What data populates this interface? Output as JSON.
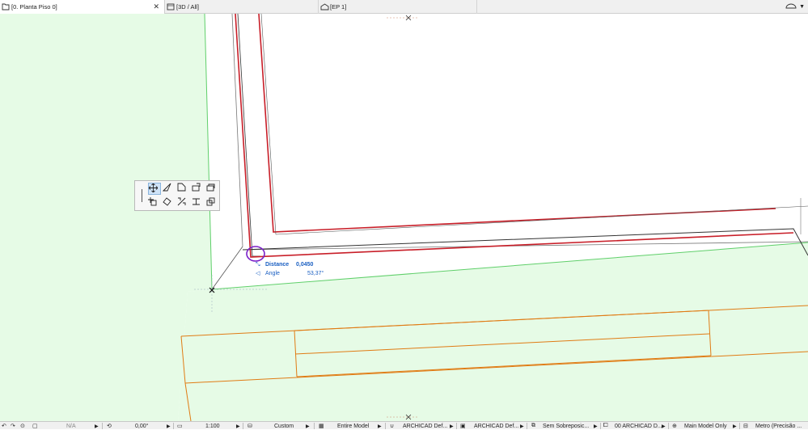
{
  "tabs": [
    {
      "label": "[0. Planta Piso 0]",
      "icon": "floor-plan-icon",
      "close": "✕"
    },
    {
      "label": "[3D / All]",
      "icon": "3d-window-icon"
    },
    {
      "label": "[EP 1]",
      "icon": "elevation-icon"
    }
  ],
  "tracker": {
    "distance_label": "Distance",
    "distance_value": "0,0450",
    "angle_label": "Angle",
    "angle_value": "53,37°"
  },
  "statusbar": {
    "na": "N/A",
    "angle": "0,00°",
    "scale": "1:100",
    "pen_set": "Custom",
    "model_view": "Entire Model",
    "layer_combo": "ARCHICAD Def...",
    "dimension_std": "ARCHICAD Def...",
    "override": "Sem Sobreposic...",
    "renovation": "00 ARCHICAD D...",
    "mvo": "Main Model Only",
    "units": "Metro (Precisão ..."
  },
  "colors": {
    "green_zone": "#e6fbe6",
    "green_line": "#5fcf6a",
    "red_wall": "#c81e28",
    "orange": "#e07b14",
    "purple": "#7a1fc8",
    "tracker_blue": "#1a5fc2"
  }
}
